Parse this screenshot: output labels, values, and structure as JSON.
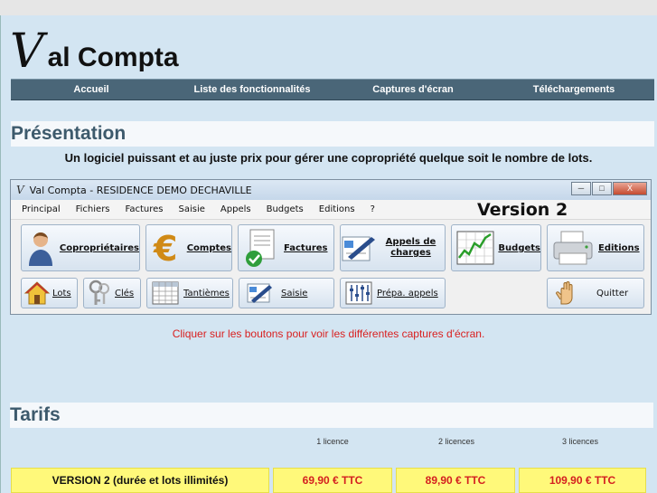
{
  "logo": {
    "letter": "V",
    "rest": "al Compta"
  },
  "nav": [
    {
      "label": "Accueil"
    },
    {
      "label": "Liste des fonctionnalités"
    },
    {
      "label": "Captures d'écran"
    },
    {
      "label": "Téléchargements"
    }
  ],
  "presentation": {
    "title": "Présentation",
    "lead": "Un logiciel puissant et au juste prix pour gérer une copropriété quelque soit le nombre de lots."
  },
  "app": {
    "window_title": "Val Compta - RESIDENCE DEMO DECHAVILLE",
    "window_controls": {
      "minimize": "─",
      "maximize": "□",
      "close": "X"
    },
    "menu": [
      "Principal",
      "Fichiers",
      "Factures",
      "Saisie",
      "Appels",
      "Budgets",
      "Editions",
      "?"
    ],
    "version": "Version 2",
    "big_buttons": [
      {
        "label": "Copropriétaires",
        "icon": "person-icon"
      },
      {
        "label": "Comptes",
        "icon": "euro-icon"
      },
      {
        "label": "Factures",
        "icon": "invoice-check-icon"
      },
      {
        "label": "Appels de charges",
        "icon": "form-pen-icon"
      },
      {
        "label": "Budgets",
        "icon": "chart-icon"
      },
      {
        "label": "Editions",
        "icon": "printer-icon"
      }
    ],
    "small_buttons": [
      {
        "label": "Lots",
        "icon": "house-icon"
      },
      {
        "label": "Clés",
        "icon": "keys-icon"
      },
      {
        "label": "Tantièmes",
        "icon": "grid-icon"
      },
      {
        "label": "Saisie",
        "icon": "form-pen-icon"
      },
      {
        "label": "Prépa. appels",
        "icon": "sliders-icon"
      },
      {
        "label": "Quitter",
        "icon": "hand-icon"
      }
    ]
  },
  "note": "Cliquer sur les boutons pour voir les différentes captures d'écran.",
  "tarifs": {
    "title": "Tarifs",
    "columns": [
      "1 licence",
      "2 licences",
      "3 licences"
    ],
    "row_label": "VERSION 2 (durée et lots illimités)",
    "prices": [
      "69,90 € TTC",
      "89,90 € TTC",
      "109,90 € TTC"
    ]
  },
  "colors": {
    "nav_bg": "#4a6678",
    "page_bg": "#d3e5f2",
    "price_bg": "#fff97a",
    "price_text": "#d42020",
    "heading": "#3d5a6c"
  }
}
